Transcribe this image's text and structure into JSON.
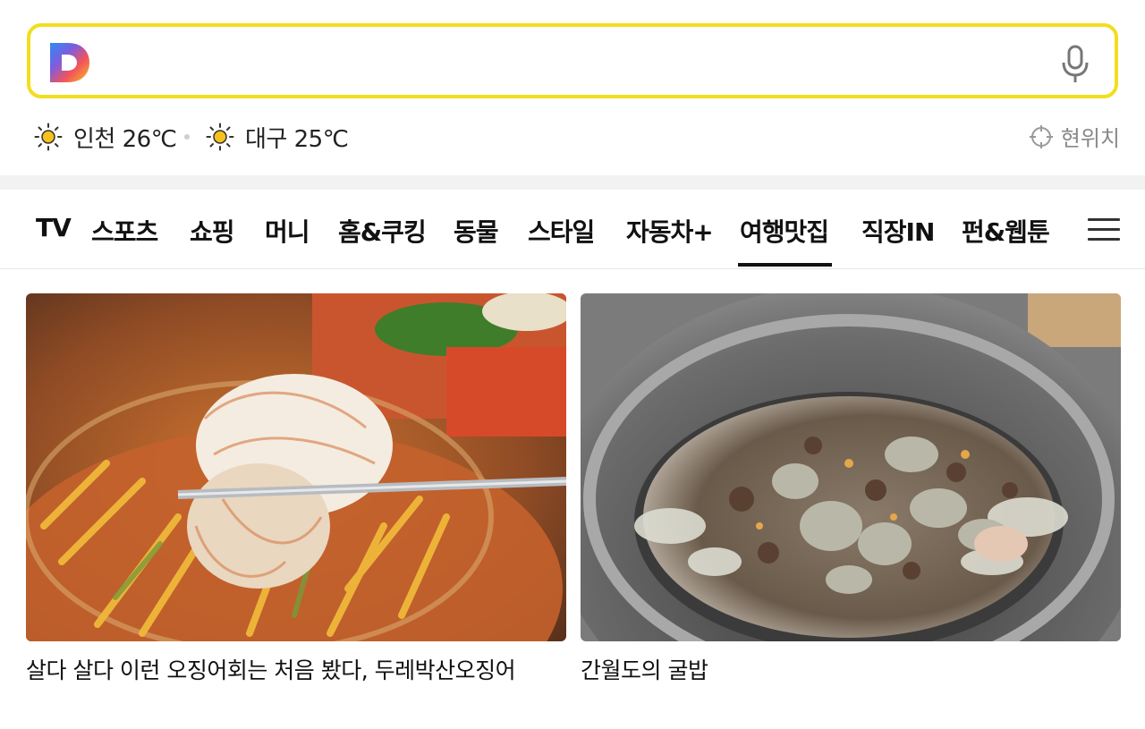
{
  "search": {
    "placeholder": ""
  },
  "weather": [
    {
      "city_temp": "인천 26℃",
      "icon": "sun-icon"
    },
    {
      "city_temp": "대구 25℃",
      "icon": "sun-icon"
    }
  ],
  "location_label": "현위치",
  "tabs": [
    {
      "label": "TV"
    },
    {
      "label": "스포츠"
    },
    {
      "label": "쇼핑"
    },
    {
      "label": "머니"
    },
    {
      "label": "홈&쿠킹"
    },
    {
      "label": "동물"
    },
    {
      "label": "스타일"
    },
    {
      "label": "자동차+"
    },
    {
      "label": "여행맛집",
      "active": true
    },
    {
      "label": "직장IN"
    },
    {
      "label": "펀&웹툰"
    }
  ],
  "cards": [
    {
      "caption": "살다 살다 이런 오징어회는 처음 봤다, 두레박산오징어"
    },
    {
      "caption": "간월도의 굴밥"
    }
  ],
  "colors": {
    "search_border": "#f2de1e",
    "active_tab_underline": "#111111"
  }
}
